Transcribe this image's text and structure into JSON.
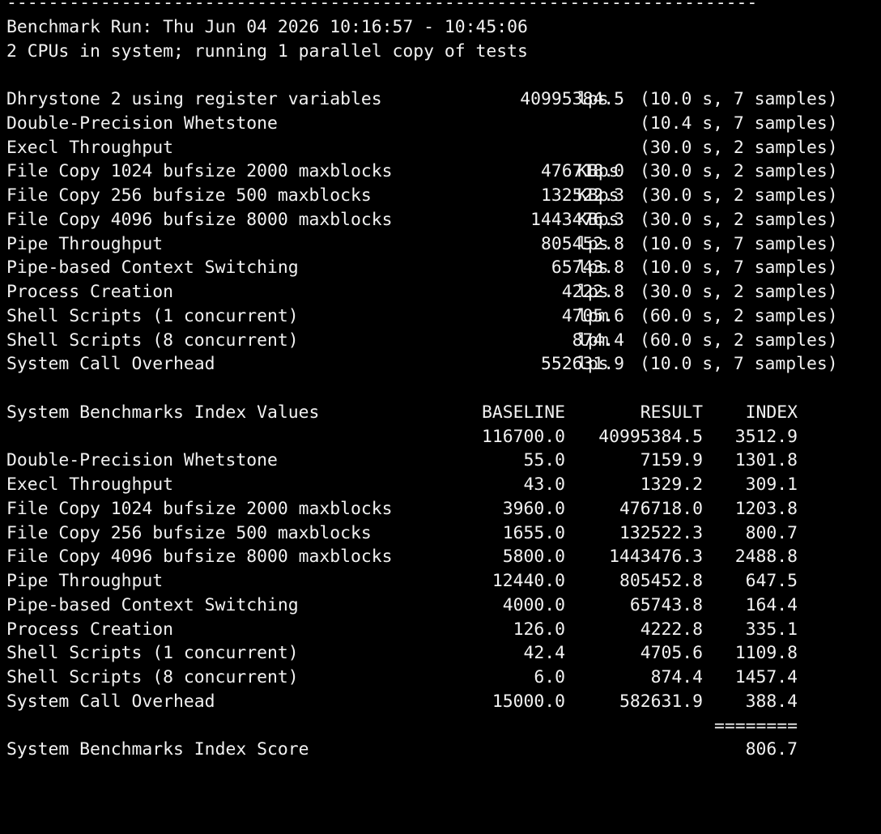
{
  "colors": {
    "background": "#000000",
    "text": "#f2f2f2"
  },
  "header": {
    "rule": "------------------------------------------------------------------------",
    "run_line": "Benchmark Run: Thu Jun 04 2026 10:16:57 - 10:45:06",
    "cpu_line": "2 CPUs in system; running 1 parallel copy of tests"
  },
  "tests": [
    {
      "name": "Dhrystone 2 using register variables",
      "value": "40995384.5",
      "unit": "lps",
      "samples": "(10.0 s, 7 samples)"
    },
    {
      "name": "Double-Precision Whetstone",
      "value": "",
      "unit": "",
      "samples": "(10.4 s, 7 samples)"
    },
    {
      "name": "Execl Throughput",
      "value": "",
      "unit": "",
      "samples": "(30.0 s, 2 samples)"
    },
    {
      "name": "File Copy 1024 bufsize 2000 maxblocks",
      "value": "476718.0",
      "unit": "KBps",
      "samples": "(30.0 s, 2 samples)"
    },
    {
      "name": "File Copy 256 bufsize 500 maxblocks",
      "value": "132522.3",
      "unit": "KBps",
      "samples": "(30.0 s, 2 samples)"
    },
    {
      "name": "File Copy 4096 bufsize 8000 maxblocks",
      "value": "1443476.3",
      "unit": "KBps",
      "samples": "(30.0 s, 2 samples)"
    },
    {
      "name": "Pipe Throughput",
      "value": "805452.8",
      "unit": "lps",
      "samples": "(10.0 s, 7 samples)"
    },
    {
      "name": "Pipe-based Context Switching",
      "value": "65743.8",
      "unit": "lps",
      "samples": "(10.0 s, 7 samples)"
    },
    {
      "name": "Process Creation",
      "value": "4222.8",
      "unit": "lps",
      "samples": "(30.0 s, 2 samples)"
    },
    {
      "name": "Shell Scripts (1 concurrent)",
      "value": "4705.6",
      "unit": "lpm",
      "samples": "(60.0 s, 2 samples)"
    },
    {
      "name": "Shell Scripts (8 concurrent)",
      "value": "874.4",
      "unit": "lpm",
      "samples": "(60.0 s, 2 samples)"
    },
    {
      "name": "System Call Overhead",
      "value": "552631.9",
      "unit": "lps",
      "samples": "(10.0 s, 7 samples)"
    }
  ],
  "index": {
    "title": "System Benchmarks Index Values",
    "baseline_header": "BASELINE",
    "result_header": "RESULT",
    "index_header": "INDEX",
    "rows": [
      {
        "name": "",
        "baseline": "116700.0",
        "result": "40995384.5",
        "index": "3512.9"
      },
      {
        "name": "Double-Precision Whetstone",
        "baseline": "55.0",
        "result": "7159.9",
        "index": "1301.8"
      },
      {
        "name": "Execl Throughput",
        "baseline": "43.0",
        "result": "1329.2",
        "index": "309.1"
      },
      {
        "name": "File Copy 1024 bufsize 2000 maxblocks",
        "baseline": "3960.0",
        "result": "476718.0",
        "index": "1203.8"
      },
      {
        "name": "File Copy 256 bufsize 500 maxblocks",
        "baseline": "1655.0",
        "result": "132522.3",
        "index": "800.7"
      },
      {
        "name": "File Copy 4096 bufsize 8000 maxblocks",
        "baseline": "5800.0",
        "result": "1443476.3",
        "index": "2488.8"
      },
      {
        "name": "Pipe Throughput",
        "baseline": "12440.0",
        "result": "805452.8",
        "index": "647.5"
      },
      {
        "name": "Pipe-based Context Switching",
        "baseline": "4000.0",
        "result": "65743.8",
        "index": "164.4"
      },
      {
        "name": "Process Creation",
        "baseline": "126.0",
        "result": "4222.8",
        "index": "335.1"
      },
      {
        "name": "Shell Scripts (1 concurrent)",
        "baseline": "42.4",
        "result": "4705.6",
        "index": "1109.8"
      },
      {
        "name": "Shell Scripts (8 concurrent)",
        "baseline": "6.0",
        "result": "874.4",
        "index": "1457.4"
      },
      {
        "name": "System Call Overhead",
        "baseline": "15000.0",
        "result": "582631.9",
        "index": "388.4"
      }
    ],
    "separator": "========",
    "score_label": "System Benchmarks Index Score",
    "score": "806.7"
  }
}
